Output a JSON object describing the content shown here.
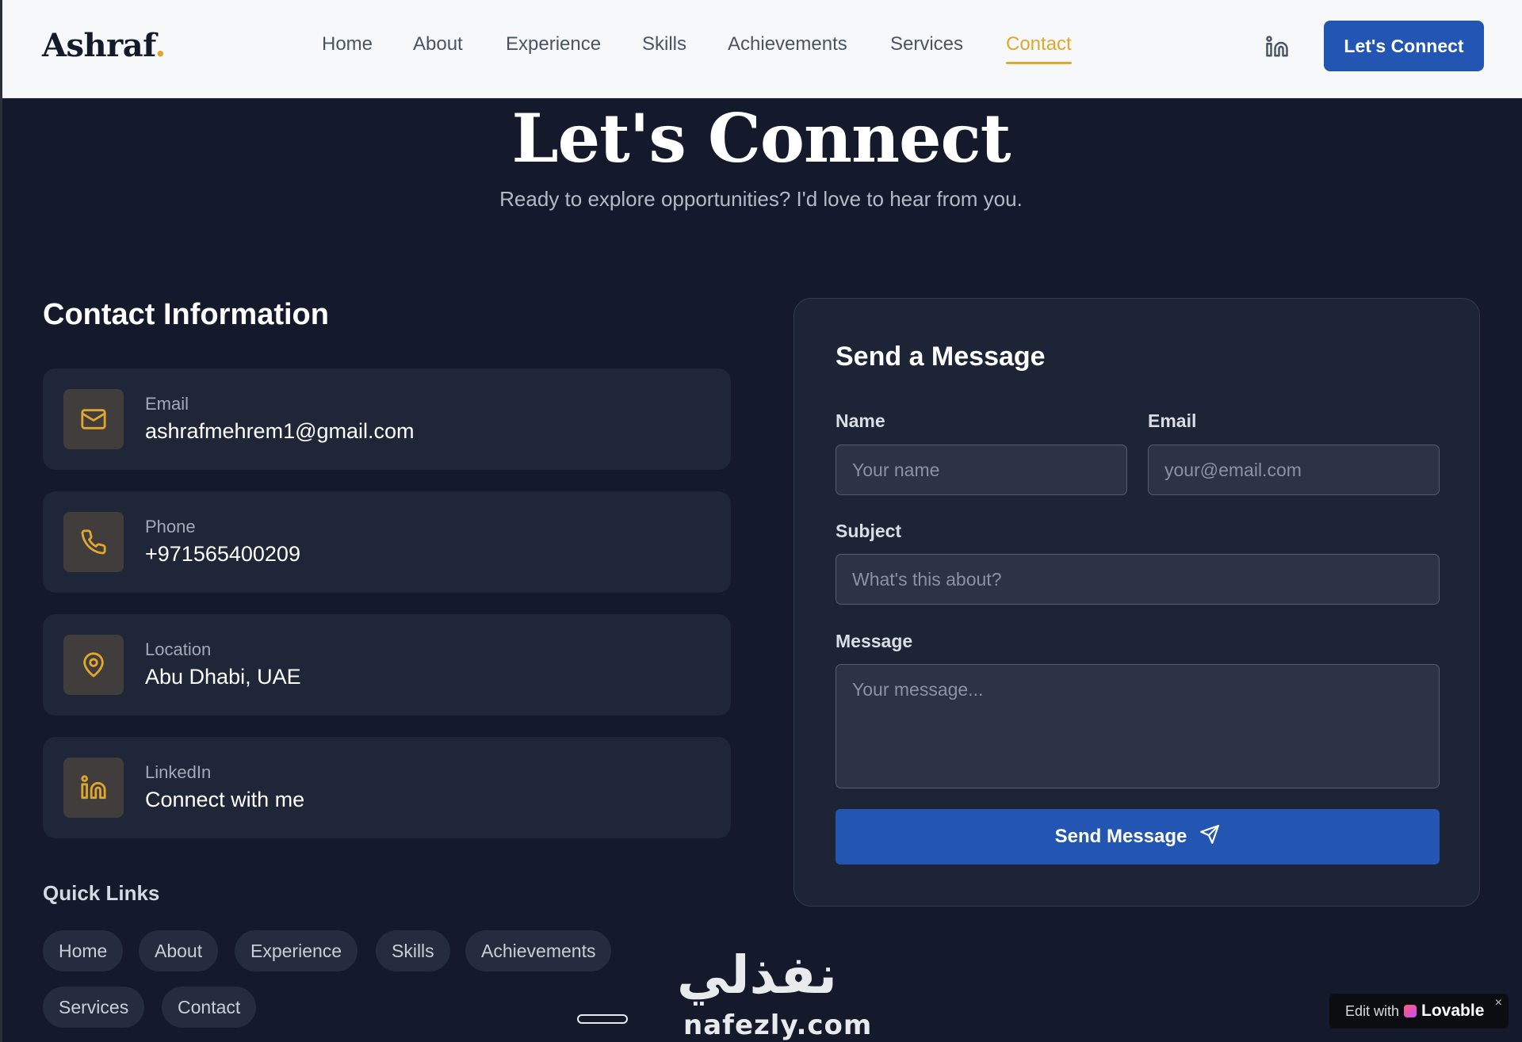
{
  "header": {
    "logo_text": "Ashraf",
    "logo_dot": ".",
    "nav": [
      {
        "label": "Home"
      },
      {
        "label": "About"
      },
      {
        "label": "Experience"
      },
      {
        "label": "Skills"
      },
      {
        "label": "Achievements"
      },
      {
        "label": "Services"
      },
      {
        "label": "Contact"
      }
    ],
    "active_nav": "Contact",
    "linkedin_icon": "linkedin-icon",
    "cta_label": "Let's Connect"
  },
  "hero": {
    "title": "Let's Connect",
    "subtitle": "Ready to explore opportunities? I'd love to hear from you."
  },
  "contact_info": {
    "title": "Contact Information",
    "items": [
      {
        "icon": "mail-icon",
        "label": "Email",
        "value": "ashrafmehrem1@gmail.com"
      },
      {
        "icon": "phone-icon",
        "label": "Phone",
        "value": "+971565400209"
      },
      {
        "icon": "map-pin-icon",
        "label": "Location",
        "value": "Abu Dhabi, UAE"
      },
      {
        "icon": "linkedin-icon",
        "label": "LinkedIn",
        "value": "Connect with me"
      }
    ]
  },
  "quick_links": {
    "title": "Quick Links",
    "items": [
      "Home",
      "About",
      "Experience",
      "Skills",
      "Achievements",
      "Services",
      "Contact"
    ]
  },
  "form": {
    "title": "Send a Message",
    "name_label": "Name",
    "name_placeholder": "Your name",
    "name_value": "",
    "email_label": "Email",
    "email_placeholder": "your@email.com",
    "email_value": "",
    "subject_label": "Subject",
    "subject_placeholder": "What's this about?",
    "subject_value": "",
    "message_label": "Message",
    "message_placeholder": "Your message...",
    "message_value": "",
    "submit_label": "Send Message",
    "submit_icon": "send-icon"
  },
  "overlays": {
    "watermark_arabic": "نفذلي",
    "watermark_latin": "nafezly.com",
    "badge_prefix": "Edit with",
    "badge_brand": "Lovable",
    "badge_close": "×"
  },
  "colors": {
    "accent": "#e0a72e",
    "primary": "#2356b3",
    "page_bg": "#141a2c",
    "card_bg": "#1f2638",
    "header_bg": "#f7f8f9"
  }
}
